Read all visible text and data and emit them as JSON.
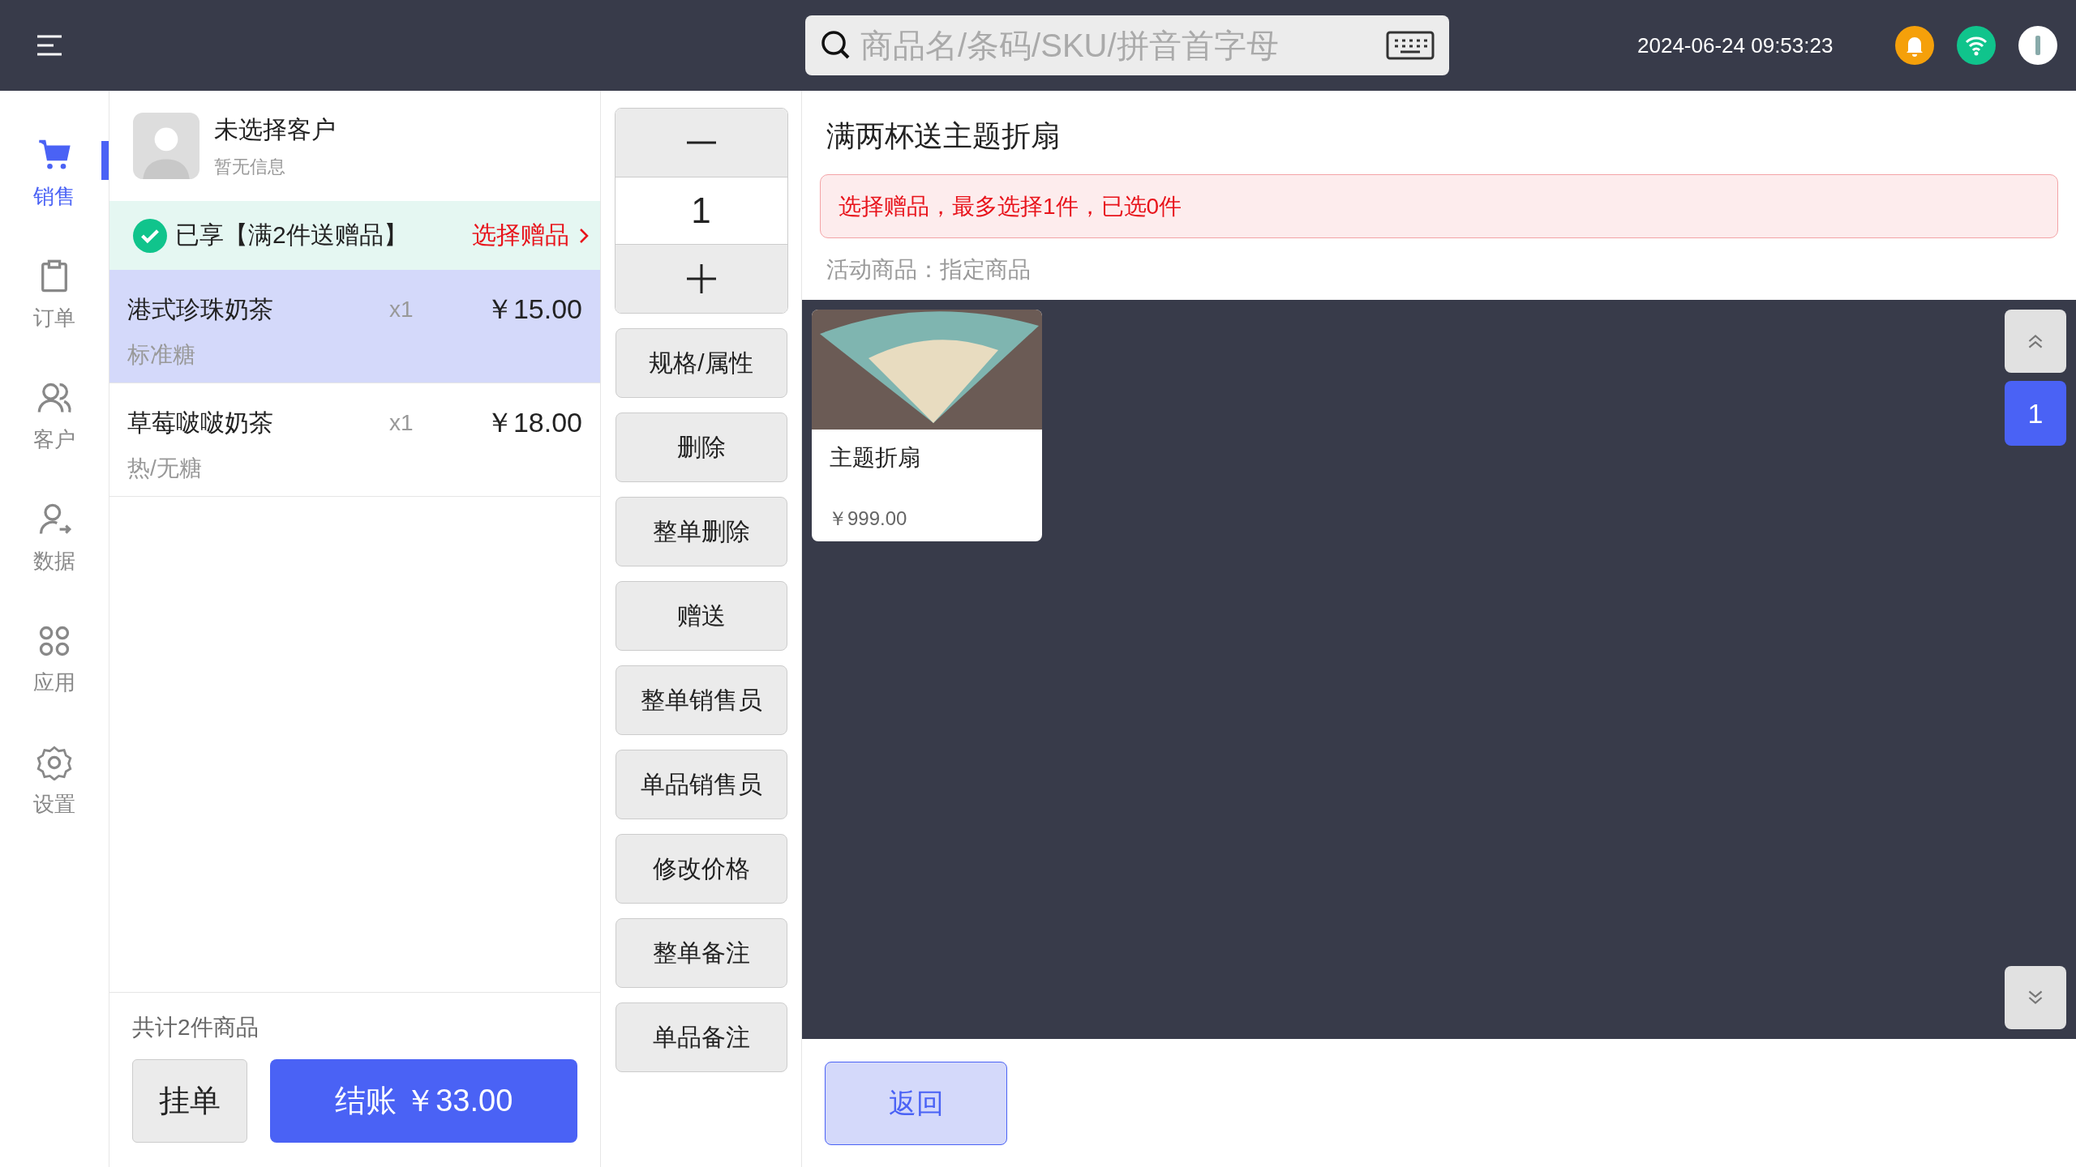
{
  "top_bar": {
    "search": {
      "placeholder": "商品名/条码/SKU/拼音首字母"
    },
    "datetime": "2024-06-24 09:53:23"
  },
  "sidebar": {
    "items": [
      {
        "kind": "cart",
        "label": "销售",
        "selected": true
      },
      {
        "kind": "clipboard",
        "label": "订单",
        "selected": false
      },
      {
        "kind": "users",
        "label": "客户",
        "selected": false
      },
      {
        "kind": "user-arrow",
        "label": "数据",
        "selected": false
      },
      {
        "kind": "apps",
        "label": "应用",
        "selected": false
      },
      {
        "kind": "gear",
        "label": "设置",
        "selected": false
      }
    ]
  },
  "customer": {
    "name": "未选择客户",
    "info": "暂无信息"
  },
  "promotion": {
    "text": "已享【满2件送赠品】",
    "link": "选择赠品"
  },
  "order_items": [
    {
      "name": "港式珍珠奶茶",
      "spec": "标准糖",
      "qty": "x1",
      "price": "￥15.00",
      "selected": true
    },
    {
      "name": "草莓啵啵奶茶",
      "spec": "热/无糖",
      "qty": "x1",
      "price": "￥18.00",
      "selected": false
    }
  ],
  "footer": {
    "total": "共计2件商品",
    "hold": "挂单",
    "checkout": "结账 ￥33.00"
  },
  "stepper": {
    "value": "1"
  },
  "actions": [
    "规格/属性",
    "删除",
    "整单删除",
    "赠送",
    "整单销售员",
    "单品销售员",
    "修改价格",
    "整单备注",
    "单品备注"
  ],
  "gift_panel": {
    "title": "满两杯送主题折扇",
    "alert": "选择赠品，最多选择1件，已选0件",
    "scope": "活动商品：指定商品",
    "products": [
      {
        "name": "主题折扇",
        "price": "￥999.00"
      }
    ],
    "page": "1",
    "back": "返回"
  }
}
